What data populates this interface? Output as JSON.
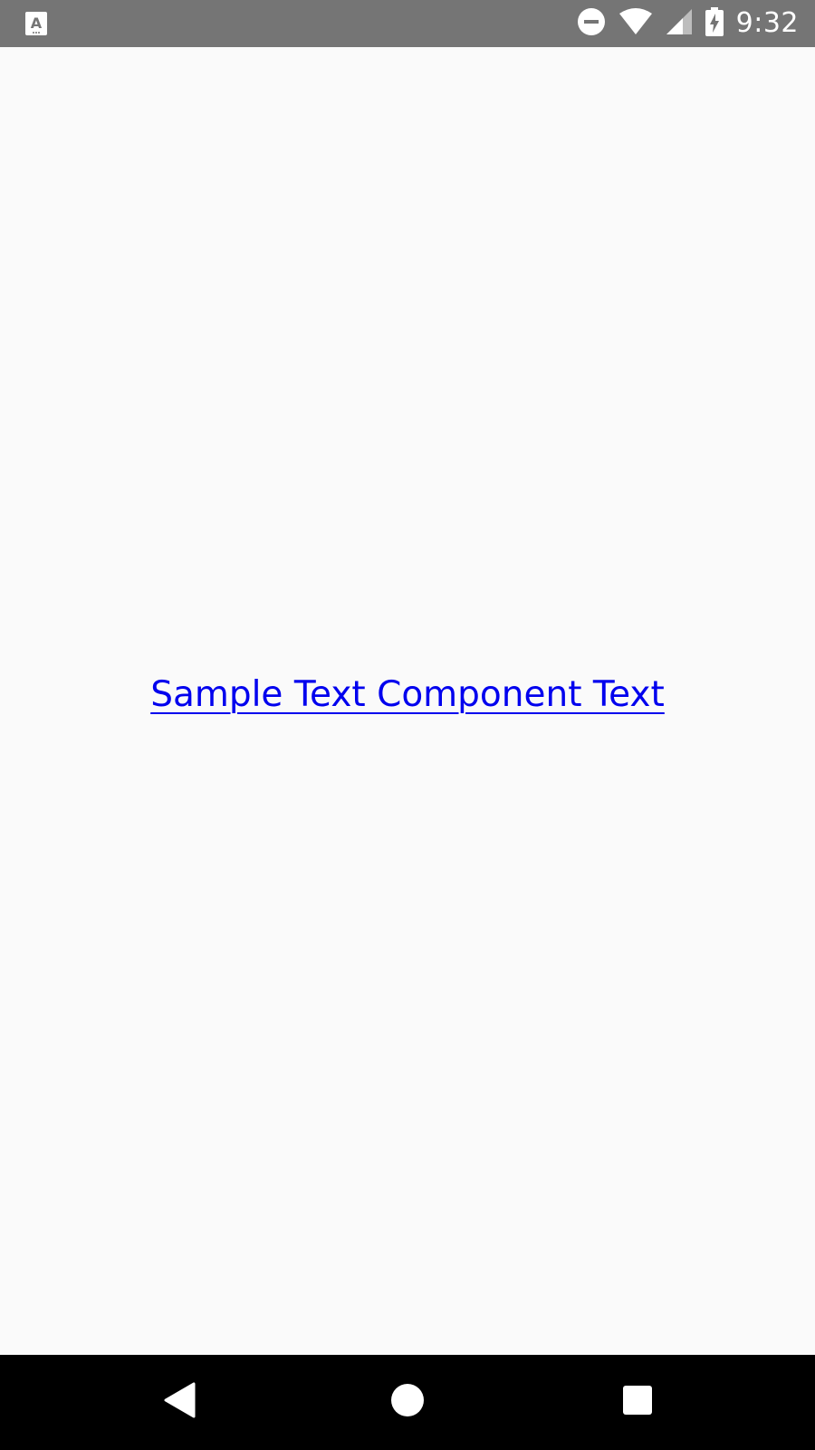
{
  "status_bar": {
    "time": "9:32",
    "notification_icon": "app-notification-icon",
    "icons": [
      "do-not-disturb-icon",
      "wifi-icon",
      "cell-signal-icon",
      "battery-charging-icon"
    ]
  },
  "content": {
    "link_text": "Sample Text Component Text",
    "link_color": "#0000ee",
    "background": "#fafafa"
  },
  "nav_bar": {
    "buttons": [
      "back-icon",
      "home-icon",
      "recents-icon"
    ]
  }
}
